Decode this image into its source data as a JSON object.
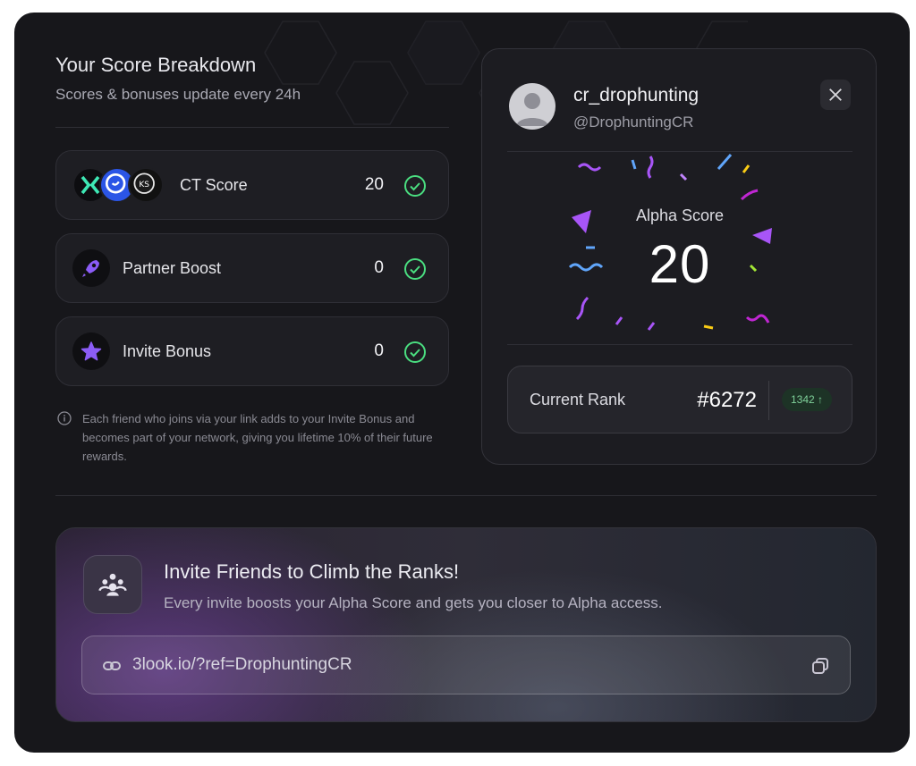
{
  "breakdown": {
    "title": "Your Score Breakdown",
    "subtitle": "Scores & bonuses update every 24h",
    "rows": [
      {
        "label": "CT Score",
        "value": "20",
        "icon": "ct-score-avatars"
      },
      {
        "label": "Partner Boost",
        "value": "0",
        "icon": "rocket-icon"
      },
      {
        "label": "Invite Bonus",
        "value": "0",
        "icon": "star-icon"
      }
    ],
    "note": "Each friend who joins via your link adds to your Invite Bonus and becomes part of your network, giving you lifetime 10% of their future rewards."
  },
  "profile": {
    "username": "cr_drophunting",
    "handle": "@DrophuntingCR",
    "alpha_label": "Alpha Score",
    "alpha_value": "20",
    "rank_label": "Current Rank",
    "rank_value": "#6272",
    "rank_change": "1342 ↑"
  },
  "invite": {
    "title": "Invite Friends to Climb the Ranks!",
    "subtitle": "Every invite boosts your Alpha Score and gets you closer to Alpha access.",
    "ref_link": "3look.io/?ref=DrophuntingCR"
  },
  "colors": {
    "card_bg": "#17171b",
    "accent_purple": "#8b5cf6",
    "check_green": "#4ade80",
    "rank_badge_text": "#7fd19a"
  }
}
